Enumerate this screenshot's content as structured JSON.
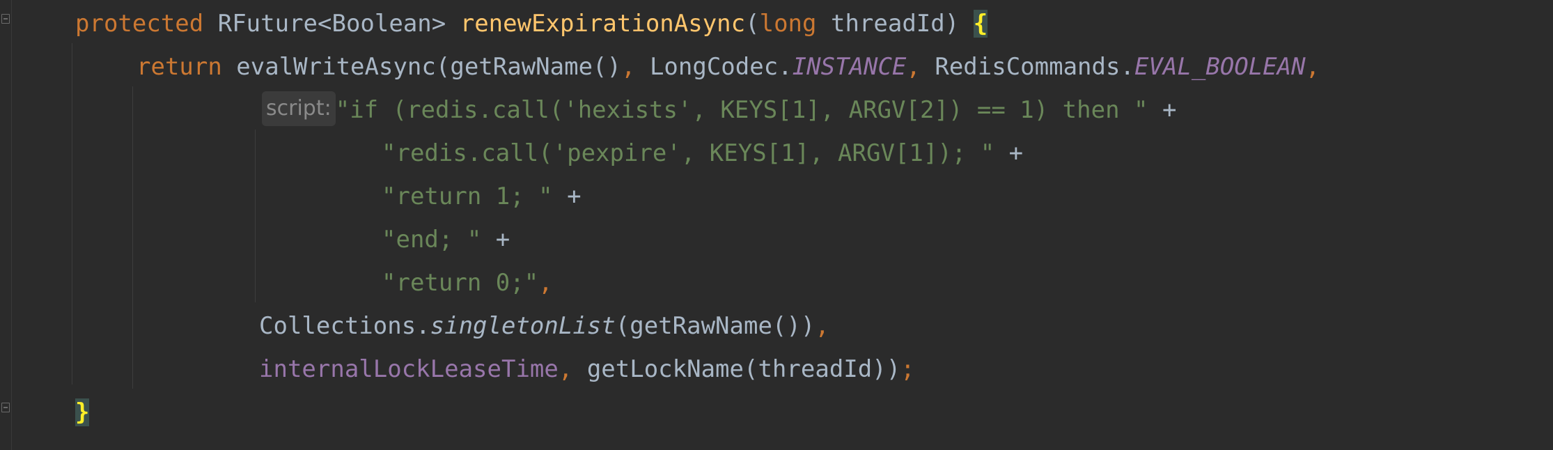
{
  "code": {
    "line1": {
      "protected": "protected",
      "type": "RFuture<Boolean>",
      "method": "renewExpirationAsync",
      "paren_open": "(",
      "param_type": "long",
      "param_name": " threadId",
      "paren_close": ")",
      "brace": "{"
    },
    "line2": {
      "return_kw": "return",
      "call": " evalWriteAsync(getRawName()",
      "comma1": ",",
      "codec": " LongCodec.",
      "instance": "INSTANCE",
      "comma2": ",",
      "commands": " RedisCommands.",
      "eval_boolean": "EVAL_BOOLEAN",
      "comma3": ","
    },
    "line3": {
      "hint": "script:",
      "str": "\"if (redis.call('hexists', KEYS[1], ARGV[2]) == 1) then \"",
      "plus": " +"
    },
    "line4": {
      "str": "\"redis.call('pexpire', KEYS[1], ARGV[1]); \"",
      "plus": " +"
    },
    "line5": {
      "str": "\"return 1; \"",
      "plus": " +"
    },
    "line6": {
      "str": "\"end; \"",
      "plus": " +"
    },
    "line7": {
      "str": "\"return 0;\"",
      "comma": ","
    },
    "line8": {
      "cls": "Collections.",
      "method": "singletonList",
      "args": "(getRawName())",
      "comma": ","
    },
    "line9": {
      "field": "internalLockLeaseTime",
      "comma": ",",
      "call": " getLockName(threadId))",
      "semi": ";"
    },
    "line10": {
      "brace": "}"
    }
  },
  "colors": {
    "background": "#2b2b2b",
    "keyword": "#cc7832",
    "method_decl": "#ffc66d",
    "string": "#6a8759",
    "field": "#9876aa",
    "plain": "#a9b7c6",
    "brace_match": "#ffef28"
  }
}
